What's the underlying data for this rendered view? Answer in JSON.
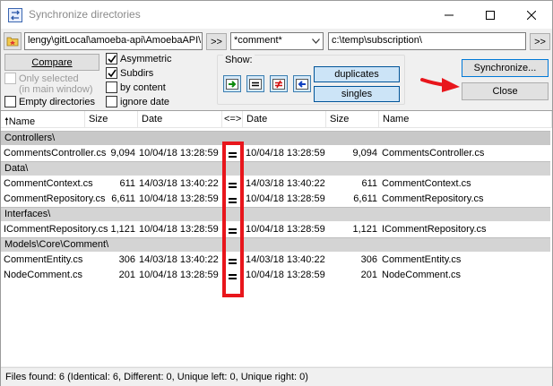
{
  "window": {
    "title": "Synchronize directories"
  },
  "paths": {
    "left": "lengy\\gitLocal\\amoeba-api\\AmoebaAPI\\",
    "filter": "*comment*",
    "right": "c:\\temp\\subscription\\",
    "browse_left_label": ">>",
    "browse_right_label": ">>"
  },
  "options": {
    "compare_label": "Compare",
    "only_selected_label": "Only selected",
    "in_main_window_label": "(in main window)",
    "empty_directories_label": "Empty directories",
    "asymmetric_label": "Asymmetric",
    "subdirs_label": "Subdirs",
    "by_content_label": "by content",
    "ignore_date_label": "ignore date",
    "asymmetric_checked": true,
    "subdirs_checked": true,
    "by_content_checked": false,
    "ignore_date_checked": false,
    "empty_directories_checked": false,
    "only_selected_checked": false
  },
  "show": {
    "label": "Show:",
    "duplicates_label": "duplicates",
    "singles_label": "singles"
  },
  "actions": {
    "synchronize_label": "Synchronize...",
    "close_label": "Close"
  },
  "columns": {
    "name_left": "Name",
    "size_left": "Size",
    "date_left": "Date",
    "compare": "<=>",
    "date_right": "Date",
    "size_right": "Size",
    "name_right": "Name"
  },
  "groups": [
    {
      "folder": "Controllers\\",
      "rows": [
        {
          "name_l": "CommentsController.cs",
          "size_l": "9,094",
          "date_l": "10/04/18 13:28:59",
          "date_r": "10/04/18 13:28:59",
          "size_r": "9,094",
          "name_r": "CommentsController.cs"
        }
      ]
    },
    {
      "folder": "Data\\",
      "rows": [
        {
          "name_l": "CommentContext.cs",
          "size_l": "611",
          "date_l": "14/03/18 13:40:22",
          "date_r": "14/03/18 13:40:22",
          "size_r": "611",
          "name_r": "CommentContext.cs"
        },
        {
          "name_l": "CommentRepository.cs",
          "size_l": "6,611",
          "date_l": "10/04/18 13:28:59",
          "date_r": "10/04/18 13:28:59",
          "size_r": "6,611",
          "name_r": "CommentRepository.cs"
        }
      ]
    },
    {
      "folder": "Interfaces\\",
      "rows": [
        {
          "name_l": "ICommentRepository.cs",
          "size_l": "1,121",
          "date_l": "10/04/18 13:28:59",
          "date_r": "10/04/18 13:28:59",
          "size_r": "1,121",
          "name_r": "ICommentRepository.cs"
        }
      ]
    },
    {
      "folder": "Models\\Core\\Comment\\",
      "rows": [
        {
          "name_l": "CommentEntity.cs",
          "size_l": "306",
          "date_l": "14/03/18 13:40:22",
          "date_r": "14/03/18 13:40:22",
          "size_r": "306",
          "name_r": "CommentEntity.cs"
        },
        {
          "name_l": "NodeComment.cs",
          "size_l": "201",
          "date_l": "10/04/18 13:28:59",
          "date_r": "10/04/18 13:28:59",
          "size_r": "201",
          "name_r": "NodeComment.cs"
        }
      ]
    }
  ],
  "status": {
    "text": "Files found: 6  (Identical: 6, Different: 0, Unique left: 0, Unique right: 0)"
  },
  "colors": {
    "annotation_red": "#e8161c",
    "toggle_blue": "#cce4f7",
    "group_gray": "#d4d4d4"
  }
}
